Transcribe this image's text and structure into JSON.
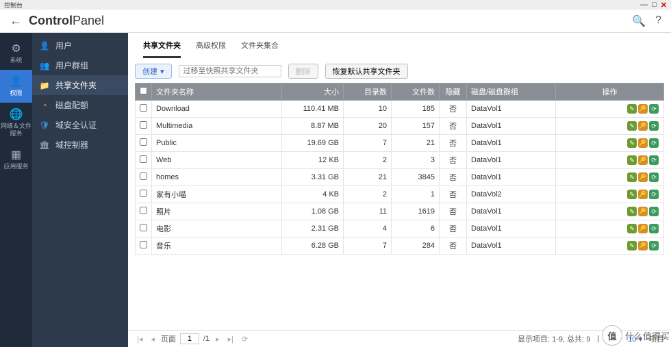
{
  "window": {
    "title": "控制台"
  },
  "header": {
    "title_bold": "Control",
    "title_light": "Panel"
  },
  "rail": [
    {
      "icon": "⚙",
      "label": "系统"
    },
    {
      "icon": "👤",
      "label": "权限"
    },
    {
      "icon": "🌐",
      "label": "网络＆文件服务"
    },
    {
      "icon": "▦",
      "label": "应用服务"
    }
  ],
  "sidebar": [
    {
      "icon": "👤",
      "label": "用户",
      "color": "#4aa3ff"
    },
    {
      "icon": "👥",
      "label": "用户群组",
      "color": "#4aa3ff"
    },
    {
      "icon": "📁",
      "label": "共享文件夹",
      "color": "#f2b84b"
    },
    {
      "icon": "◔",
      "label": "磁盘配额",
      "color": "#ff8a3c"
    },
    {
      "icon": "🛡",
      "label": "域安全认证",
      "color": "#3aa0e0"
    },
    {
      "icon": "🏛",
      "label": "域控制器",
      "color": "#b7c2cf"
    }
  ],
  "tabs": [
    {
      "label": "共享文件夹",
      "active": true
    },
    {
      "label": "高级权限",
      "active": false
    },
    {
      "label": "文件夹集合",
      "active": false
    }
  ],
  "toolbar": {
    "create": "创建",
    "search_placeholder": "过移至快照共享文件夹",
    "delete": "删除",
    "restore": "恢复默认共享文件夹"
  },
  "columns": [
    "文件夹名称",
    "大小",
    "目录数",
    "文件数",
    "隐藏",
    "磁盘/磁盘群组",
    "操作"
  ],
  "rows": [
    {
      "name": "Download",
      "size": "110.41 MB",
      "dirs": 10,
      "files": 185,
      "hidden": "否",
      "vol": "DataVol1"
    },
    {
      "name": "Multimedia",
      "size": "8.87 MB",
      "dirs": 20,
      "files": 157,
      "hidden": "否",
      "vol": "DataVol1"
    },
    {
      "name": "Public",
      "size": "19.69 GB",
      "dirs": 7,
      "files": 21,
      "hidden": "否",
      "vol": "DataVol1"
    },
    {
      "name": "Web",
      "size": "12 KB",
      "dirs": 2,
      "files": 3,
      "hidden": "否",
      "vol": "DataVol1"
    },
    {
      "name": "homes",
      "size": "3.31 GB",
      "dirs": 21,
      "files": 3845,
      "hidden": "否",
      "vol": "DataVol1"
    },
    {
      "name": "家有小喵",
      "size": "4 KB",
      "dirs": 2,
      "files": 1,
      "hidden": "否",
      "vol": "DataVol2"
    },
    {
      "name": "照片",
      "size": "1.08 GB",
      "dirs": 11,
      "files": 1619,
      "hidden": "否",
      "vol": "DataVol1"
    },
    {
      "name": "电影",
      "size": "2.31 GB",
      "dirs": 4,
      "files": 6,
      "hidden": "否",
      "vol": "DataVol1"
    },
    {
      "name": "音乐",
      "size": "6.28 GB",
      "dirs": 7,
      "files": 284,
      "hidden": "否",
      "vol": "DataVol1"
    }
  ],
  "pager": {
    "page_label": "页面",
    "page": "1",
    "total_pages": "/1",
    "summary": "显示项目: 1-9, 总共: 9",
    "show_label": "显示",
    "show_count": "10",
    "items_label": "项目"
  },
  "watermark": {
    "mark": "值",
    "text": "什么值得买"
  }
}
